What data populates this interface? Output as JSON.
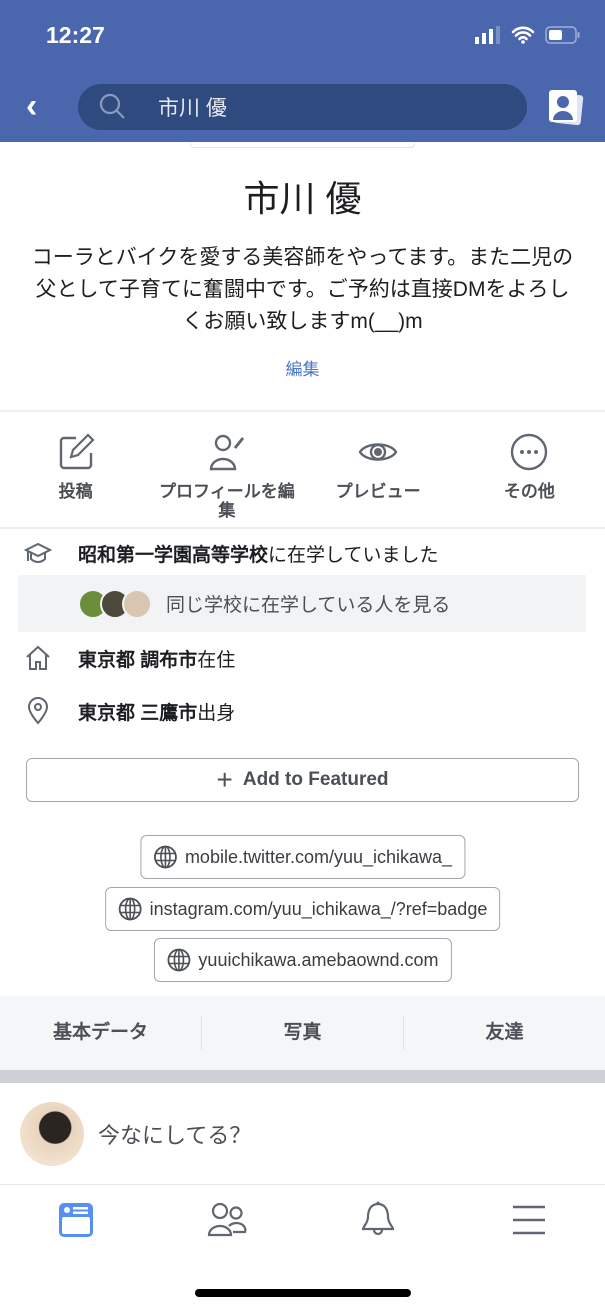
{
  "status_bar": {
    "time": "12:27"
  },
  "nav": {
    "search_value": "市川 優"
  },
  "profile": {
    "name": "市川 優",
    "bio": "コーラとバイクを愛する美容師をやってます。また二児の父として子育てに奮闘中です。ご予約は直接DMをよろしくお願い致しますm(__)m",
    "edit_label": "編集"
  },
  "actions": [
    {
      "label": "投稿",
      "icon": "compose-icon"
    },
    {
      "label": "プロフィールを編集",
      "icon": "edit-profile-icon"
    },
    {
      "label": "プレビュー",
      "icon": "eye-icon"
    },
    {
      "label": "その他",
      "icon": "more-icon"
    }
  ],
  "info": {
    "education": {
      "bold": "昭和第一学園高等学校",
      "rest": "に在学していました"
    },
    "same_school": "同じ学校に在学している人を見る",
    "lives": {
      "bold": "東京都 調布市",
      "rest": "在住"
    },
    "from": {
      "bold": "東京都 三鷹市",
      "rest": "出身"
    }
  },
  "featured_label": "Add to Featured",
  "links": [
    "mobile.twitter.com/yuu_ichikawa_",
    "instagram.com/yuu_ichikawa_/?ref=badge",
    "yuuichikawa.amebaownd.com"
  ],
  "tabs": [
    "基本データ",
    "写真",
    "友達"
  ],
  "composer_placeholder": "今なにしてる？",
  "colors": {
    "nav": "#4a67ae",
    "search": "#2f4a7e",
    "accent": "#4a76c9",
    "active_tab": "#5890f0"
  }
}
